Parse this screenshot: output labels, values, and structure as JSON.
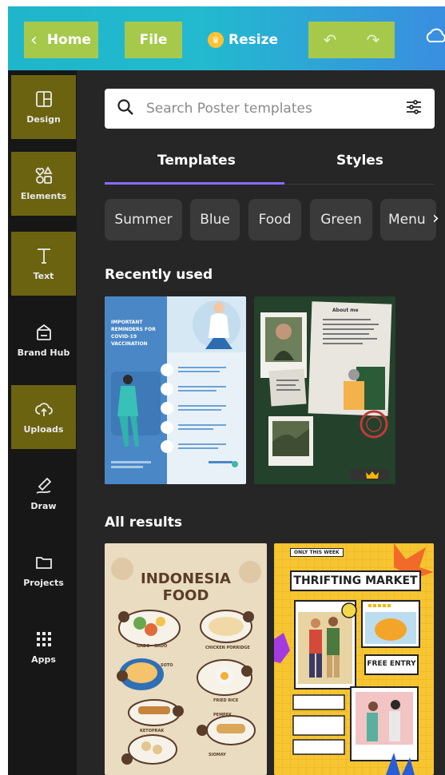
{
  "topbar": {
    "home_label": "Home",
    "file_label": "File",
    "resize_label": "Resize"
  },
  "sidebar": {
    "items": [
      {
        "label": "Design",
        "icon": "layout-icon"
      },
      {
        "label": "Elements",
        "icon": "shapes-icon"
      },
      {
        "label": "Text",
        "icon": "text-icon"
      },
      {
        "label": "Brand Hub",
        "icon": "brand-hub-icon"
      },
      {
        "label": "Uploads",
        "icon": "cloud-upload-icon"
      },
      {
        "label": "Draw",
        "icon": "draw-icon"
      },
      {
        "label": "Projects",
        "icon": "folder-icon"
      },
      {
        "label": "Apps",
        "icon": "apps-grid-icon"
      }
    ]
  },
  "search": {
    "placeholder": "Search Poster templates"
  },
  "tabs": [
    {
      "label": "Templates"
    },
    {
      "label": "Styles"
    }
  ],
  "chips": [
    "Summer",
    "Blue",
    "Food",
    "Green",
    "Menu"
  ],
  "recent": {
    "title": "Recently used",
    "items": [
      {
        "heading": "IMPORTANT REMINDERS FOR COVID-19 VACCINATION",
        "steps": [
          "1",
          "2",
          "3",
          "4",
          "5"
        ]
      },
      {
        "heading": "About me"
      }
    ]
  },
  "results": {
    "title": "All results",
    "items": [
      {
        "heading_line1": "INDONESIA",
        "heading_line2": "FOOD",
        "dishes": [
          "GADO - GADO",
          "CHICKEN PORRIDGE",
          "SOTO",
          "FRIED RICE",
          "KETOPRAK",
          "PEMPEK",
          "SIOMAY"
        ]
      },
      {
        "tag": "ONLY THIS WEEK",
        "heading": "THRIFTING MARKET",
        "cta": "FREE ENTRY"
      }
    ]
  },
  "colors": {
    "topbar_start": "#1fb6cc",
    "topbar_end": "#3a8ee0",
    "highlight": "#a6c94c",
    "sidebar_highlight": "#6b6310",
    "panel_bg": "#262626",
    "tab_accent": "#8b6cff"
  }
}
